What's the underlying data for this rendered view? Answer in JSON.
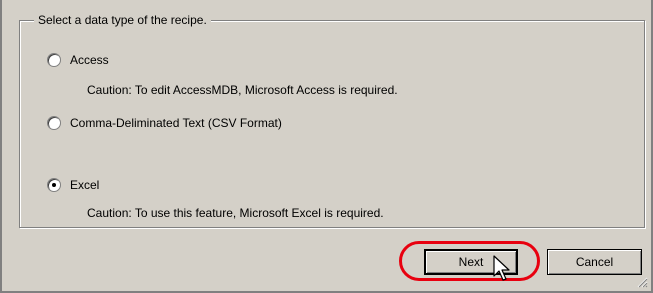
{
  "group": {
    "title": "Select a data type of the recipe."
  },
  "options": [
    {
      "label": "Access",
      "checked": false
    },
    {
      "label": "Comma-Deliminated Text (CSV Format)",
      "checked": false
    },
    {
      "label": "Excel",
      "checked": true
    }
  ],
  "cautions": {
    "access": "Caution: To edit AccessMDB, Microsoft Access is required.",
    "excel": "Caution: To use this feature, Microsoft Excel is required."
  },
  "buttons": {
    "next_label": "Next",
    "cancel_label": "Cancel"
  },
  "colors": {
    "highlight": "#e8000f",
    "dialog_bg": "#d4d0c8"
  }
}
